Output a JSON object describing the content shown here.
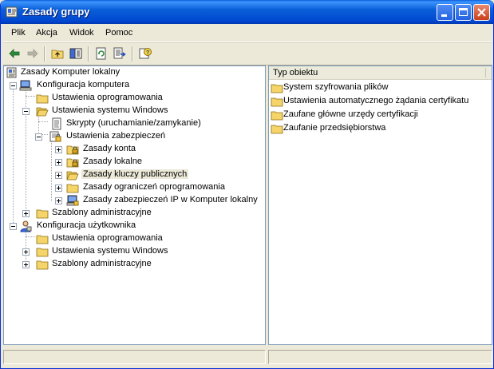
{
  "window": {
    "title": "Zasady grupy"
  },
  "menu": [
    "Plik",
    "Akcja",
    "Widok",
    "Pomoc"
  ],
  "toolbar": {
    "icons": [
      "back-arrow-icon",
      "forward-arrow-icon",
      "up-folder-icon",
      "show-tree-icon",
      "refresh-icon",
      "export-list-icon",
      "help-icon"
    ]
  },
  "tree": [
    {
      "label": "Zasady Komputer lokalny",
      "icon": "policy-icon"
    },
    {
      "label": "Konfiguracja komputera",
      "icon": "computer-icon"
    },
    {
      "label": "Ustawienia oprogramowania",
      "icon": "folder-icon"
    },
    {
      "label": "Ustawienia systemu Windows",
      "icon": "folder-icon"
    },
    {
      "label": "Skrypty (uruchamianie/zamykanie)",
      "icon": "script-icon"
    },
    {
      "label": "Ustawienia zabezpieczeń",
      "icon": "security-icon"
    },
    {
      "label": "Zasady konta",
      "icon": "lock-folder-icon"
    },
    {
      "label": "Zasady lokalne",
      "icon": "lock-folder-icon"
    },
    {
      "label": "Zasady kluczy publicznych",
      "icon": "folder-icon"
    },
    {
      "label": "Zasady ograniczeń oprogramowania",
      "icon": "folder-icon"
    },
    {
      "label": "Zasady zabezpieczeń IP w Komputer lokalny",
      "icon": "ip-security-icon"
    },
    {
      "label": "Szablony administracyjne",
      "icon": "folder-icon"
    },
    {
      "label": "Konfiguracja użytkownika",
      "icon": "user-icon"
    },
    {
      "label": "Ustawienia oprogramowania",
      "icon": "folder-icon"
    },
    {
      "label": "Ustawienia systemu Windows",
      "icon": "folder-icon"
    },
    {
      "label": "Szablony administracyjne",
      "icon": "folder-icon"
    }
  ],
  "list": {
    "column": "Typ obiektu",
    "items": [
      "System szyfrowania plików",
      "Ustawienia automatycznego żądania certyfikatu",
      "Zaufane główne urzędy certyfikacji",
      "Zaufanie przedsiębiorstwa"
    ]
  },
  "colors": {
    "title_bar": "#0a5fd8",
    "selection": "#ece9d8",
    "folder": "#f5d46a"
  }
}
